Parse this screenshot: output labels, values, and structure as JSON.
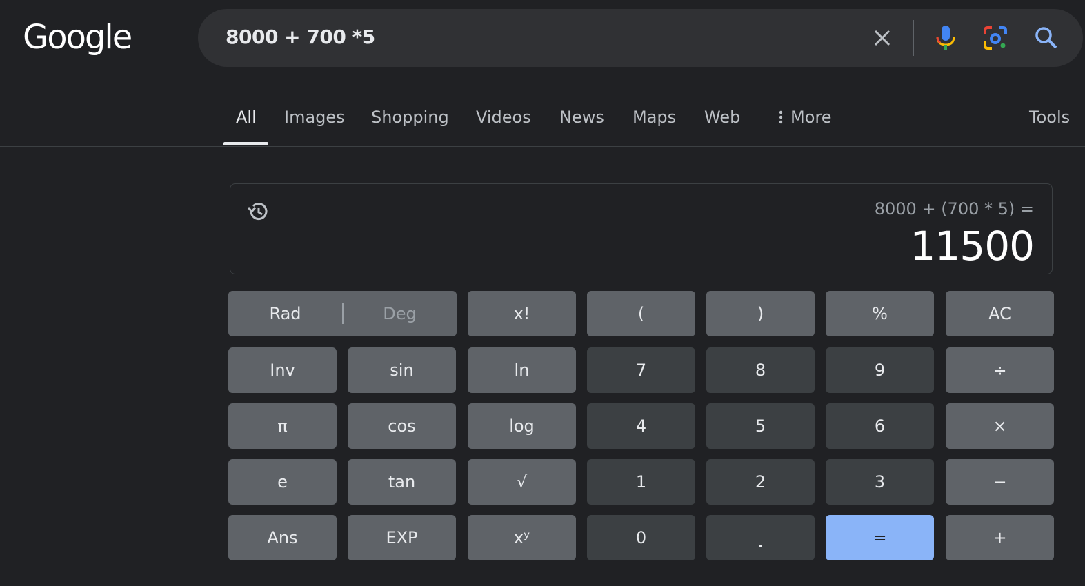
{
  "logo": "Google",
  "search": {
    "query": "8000 + 700 *5",
    "icons": [
      "close-icon",
      "microphone-icon",
      "lens-camera-icon",
      "search-icon"
    ]
  },
  "tabs": [
    {
      "label": "All",
      "active": true
    },
    {
      "label": "Images"
    },
    {
      "label": "Shopping"
    },
    {
      "label": "Videos"
    },
    {
      "label": "News"
    },
    {
      "label": "Maps"
    },
    {
      "label": "Web"
    },
    {
      "label": "More"
    }
  ],
  "tools_label": "Tools",
  "calculator": {
    "expression": "8000 + (700 * 5) =",
    "result": "11500",
    "rad_label": "Rad",
    "deg_label": "Deg",
    "keys": {
      "fact": "x!",
      "lparen": "(",
      "rparen": ")",
      "percent": "%",
      "ac": "AC",
      "inv": "Inv",
      "sin": "sin",
      "ln": "ln",
      "k7": "7",
      "k8": "8",
      "k9": "9",
      "divide": "÷",
      "pi": "π",
      "cos": "cos",
      "log": "log",
      "k4": "4",
      "k5": "5",
      "k6": "6",
      "multiply": "×",
      "e": "e",
      "tan": "tan",
      "sqrt": "√",
      "k1": "1",
      "k2": "2",
      "k3": "3",
      "minus": "−",
      "ans": "Ans",
      "exp": "EXP",
      "pow": "xʸ",
      "k0": "0",
      "dot": ".",
      "equals": "=",
      "plus": "+"
    }
  },
  "colors": {
    "background": "#202124",
    "search_bar": "#303134",
    "fn_key": "#5f6368",
    "num_key": "#3c4043",
    "equals_key": "#8ab4f8"
  }
}
